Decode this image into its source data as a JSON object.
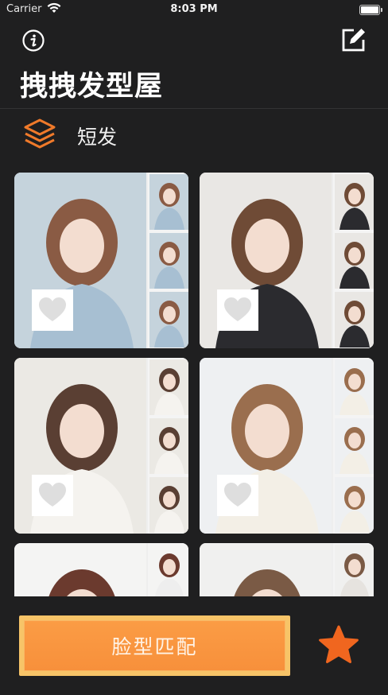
{
  "status_bar": {
    "carrier": "Carrier",
    "time": "8:03 PM"
  },
  "header": {
    "title": "拽拽发型屋",
    "info_icon": "info-icon",
    "edit_icon": "edit-icon"
  },
  "category": {
    "label": "短发",
    "icon": "layers-icon"
  },
  "photos": [
    {
      "name": "hairstyle-photo-1",
      "palette": [
        "#c5d3dc",
        "#8a5b44",
        "#a7bfd2"
      ]
    },
    {
      "name": "hairstyle-photo-2",
      "palette": [
        "#e9e7e4",
        "#6f4b36",
        "#2b2b2f"
      ]
    },
    {
      "name": "hairstyle-photo-3",
      "palette": [
        "#ebe9e4",
        "#5a3f33",
        "#f5f3ef"
      ]
    },
    {
      "name": "hairstyle-photo-4",
      "palette": [
        "#eef0f2",
        "#9a6e4e",
        "#f3efe6"
      ]
    },
    {
      "name": "hairstyle-photo-5",
      "palette": [
        "#f4f4f3",
        "#6b3a2e",
        "#eeeeee"
      ]
    },
    {
      "name": "hairstyle-photo-6",
      "palette": [
        "#f0f0ef",
        "#7a5a45",
        "#e6e3df"
      ]
    }
  ],
  "bottom_bar": {
    "face_match_label": "脸型匹配",
    "favorites_icon": "star-icon"
  },
  "colors": {
    "background": "#1f1f20",
    "accent_orange": "#f7903b",
    "button_border": "#f7c468",
    "star": "#f0661f"
  }
}
